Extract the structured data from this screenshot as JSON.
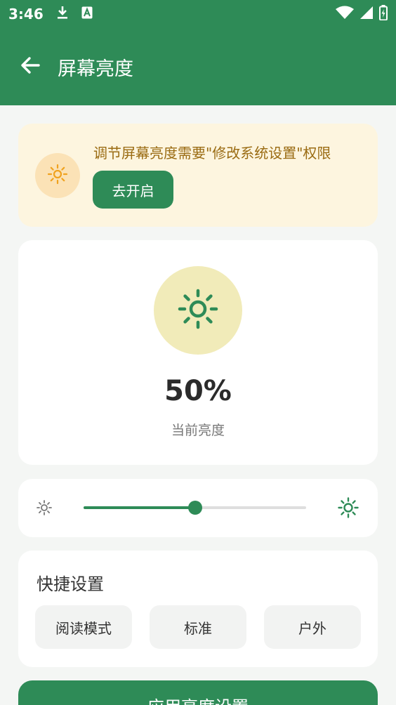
{
  "status_bar": {
    "time": "3:46"
  },
  "app_bar": {
    "title": "屏幕亮度"
  },
  "permission": {
    "message": "调节屏幕亮度需要\"修改系统设置\"权限",
    "button_label": "去开启"
  },
  "brightness": {
    "percent_text": "50%",
    "label": "当前亮度",
    "level": 0.5
  },
  "quick_settings": {
    "title": "快捷设置",
    "options": [
      "阅读模式",
      "标准",
      "户外"
    ]
  },
  "apply_button_label": "应用亮度设置",
  "colors": {
    "primary": "#2e8b57",
    "warning_bg": "#fdf5df",
    "warning_text": "#9a6b12",
    "sun_bg": "#f1ebb9",
    "warning_icon": "#f0a21f"
  }
}
